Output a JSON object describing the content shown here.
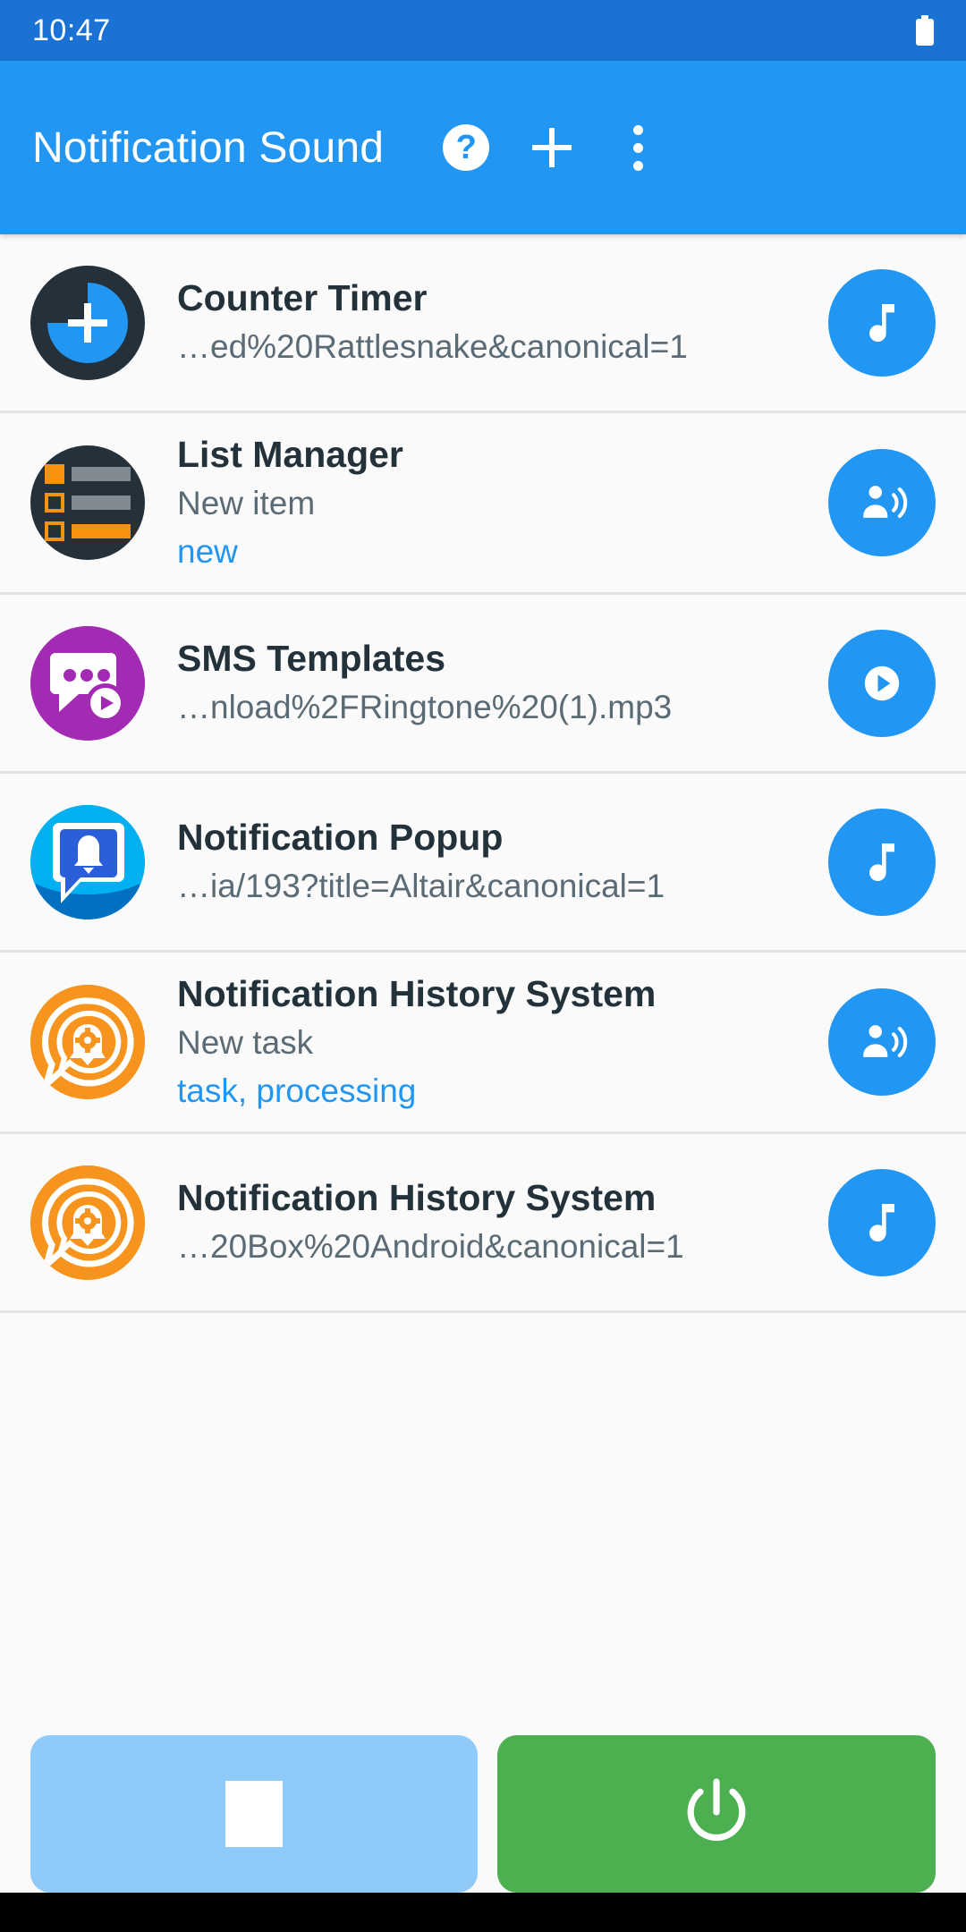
{
  "status_bar": {
    "time": "10:47",
    "battery_icon": "battery-full-icon"
  },
  "app_bar": {
    "title": "Notification Sound",
    "help_label": "?",
    "help_icon": "help-circle-icon",
    "add_icon": "plus-icon",
    "overflow_icon": "more-vert-icon"
  },
  "colors": {
    "status_bar": "#1a73d4",
    "app_bar": "#2196f3",
    "accent": "#2196f3",
    "link": "#2196f3",
    "stop_button": "#90caf9",
    "power_button": "#4caf50",
    "orange": "#f7941e",
    "purple": "#a32bb3",
    "dark": "#24303a"
  },
  "list": {
    "items": [
      {
        "title": "Counter Timer",
        "subtitle": "…ed%20Rattlesnake&canonical=1",
        "tags": "",
        "app_icon": "counter-timer-icon",
        "action_icon": "music-note-icon"
      },
      {
        "title": "List Manager",
        "subtitle": "New item",
        "tags": "new",
        "app_icon": "list-manager-icon",
        "action_icon": "text-to-speech-icon"
      },
      {
        "title": "SMS Templates",
        "subtitle": "…nload%2FRingtone%20(1).mp3",
        "tags": "",
        "app_icon": "sms-templates-icon",
        "action_icon": "play-circle-icon"
      },
      {
        "title": "Notification Popup",
        "subtitle": "…ia/193?title=Altair&canonical=1",
        "tags": "",
        "app_icon": "notification-popup-icon",
        "action_icon": "music-note-icon"
      },
      {
        "title": "Notification History System",
        "subtitle": "New task",
        "tags": "task, processing",
        "app_icon": "notification-history-icon",
        "action_icon": "text-to-speech-icon"
      },
      {
        "title": "Notification History System",
        "subtitle": "…20Box%20Android&canonical=1",
        "tags": "",
        "app_icon": "notification-history-icon",
        "action_icon": "music-note-icon"
      }
    ]
  },
  "bottom_bar": {
    "stop_icon": "stop-square-icon",
    "power_icon": "power-icon"
  }
}
